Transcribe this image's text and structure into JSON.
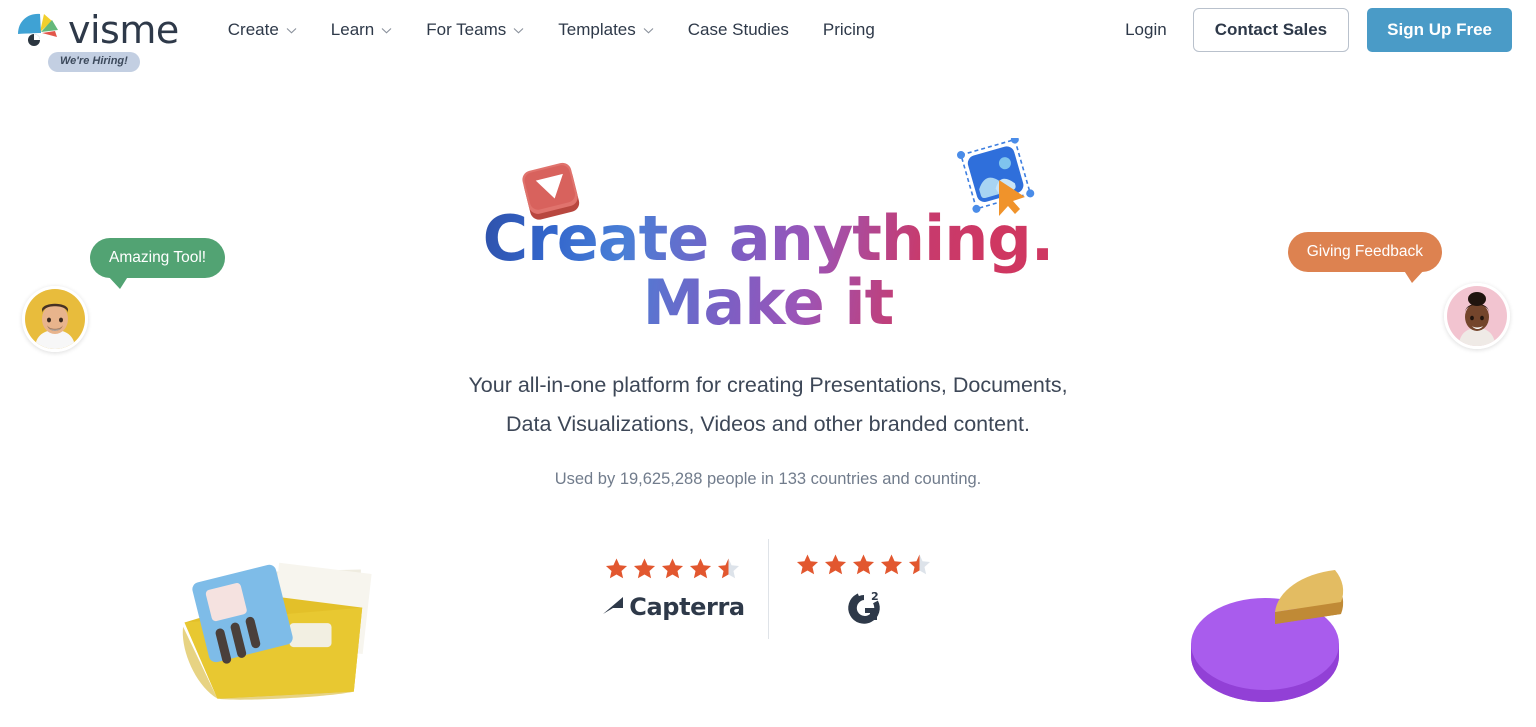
{
  "brand": {
    "name": "visme",
    "logo_icon": "visme-fan-logo",
    "hiring_badge": "We're Hiring!"
  },
  "nav": {
    "items": [
      {
        "label": "Create",
        "has_dropdown": true,
        "icon": "chevron-down-icon"
      },
      {
        "label": "Learn",
        "has_dropdown": true,
        "icon": "chevron-down-icon"
      },
      {
        "label": "For Teams",
        "has_dropdown": true,
        "icon": "chevron-down-icon"
      },
      {
        "label": "Templates",
        "has_dropdown": true,
        "icon": "chevron-down-icon"
      },
      {
        "label": "Case Studies",
        "has_dropdown": false,
        "icon": ""
      },
      {
        "label": "Pricing",
        "has_dropdown": false,
        "icon": ""
      }
    ]
  },
  "header_actions": {
    "login_label": "Login",
    "contact_sales_label": "Contact Sales",
    "signup_label": "Sign Up Free",
    "signup_bg_color": "#4a9bc7"
  },
  "hero": {
    "headline_line1": "Create anything.",
    "headline_line2": "Make it",
    "headline_gradient_from": "#2d4a9e",
    "headline_gradient_mid": "#7b5fc4",
    "headline_gradient_to": "#cf3761",
    "subhead_line1": "Your all-in-one platform for creating Presentations, Documents,",
    "subhead_line2": "Data Visualizations, Videos and other branded content.",
    "used_by": "Used by 19,625,288 people in 133 countries and counting."
  },
  "ratings": {
    "star_filled_color": "#e2572f",
    "star_empty_color": "#dde3ea",
    "cards": [
      {
        "name": "Capterra",
        "logo_icon": "capterra-logo",
        "rating": 4.5,
        "stars_total": 5
      },
      {
        "name": "G2",
        "logo_icon": "g2-logo",
        "rating": 4.5,
        "stars_total": 5
      }
    ]
  },
  "testimonials": [
    {
      "text": "Amazing Tool!",
      "bubble_color": "#52a373",
      "avatar_icon": "avatar-man-photo",
      "avatar_bg": "#e8bc3c",
      "position": "left"
    },
    {
      "text": "Giving Feedback",
      "bubble_color": "#dd8250",
      "avatar_icon": "avatar-woman-photo",
      "avatar_bg": "#f2c4d0",
      "position": "right"
    }
  ],
  "decorations": [
    {
      "icon": "play-button-3d-icon",
      "color": "#d9625f",
      "position": "top-center-left"
    },
    {
      "icon": "image-select-3d-icon",
      "color": "#2f6fdb",
      "position": "top-center-right"
    },
    {
      "icon": "folder-files-3d-icon",
      "color": "#e3c029",
      "position": "bottom-left"
    },
    {
      "icon": "pie-chart-3d-icon",
      "color": "#a457e8",
      "position": "bottom-right"
    }
  ]
}
